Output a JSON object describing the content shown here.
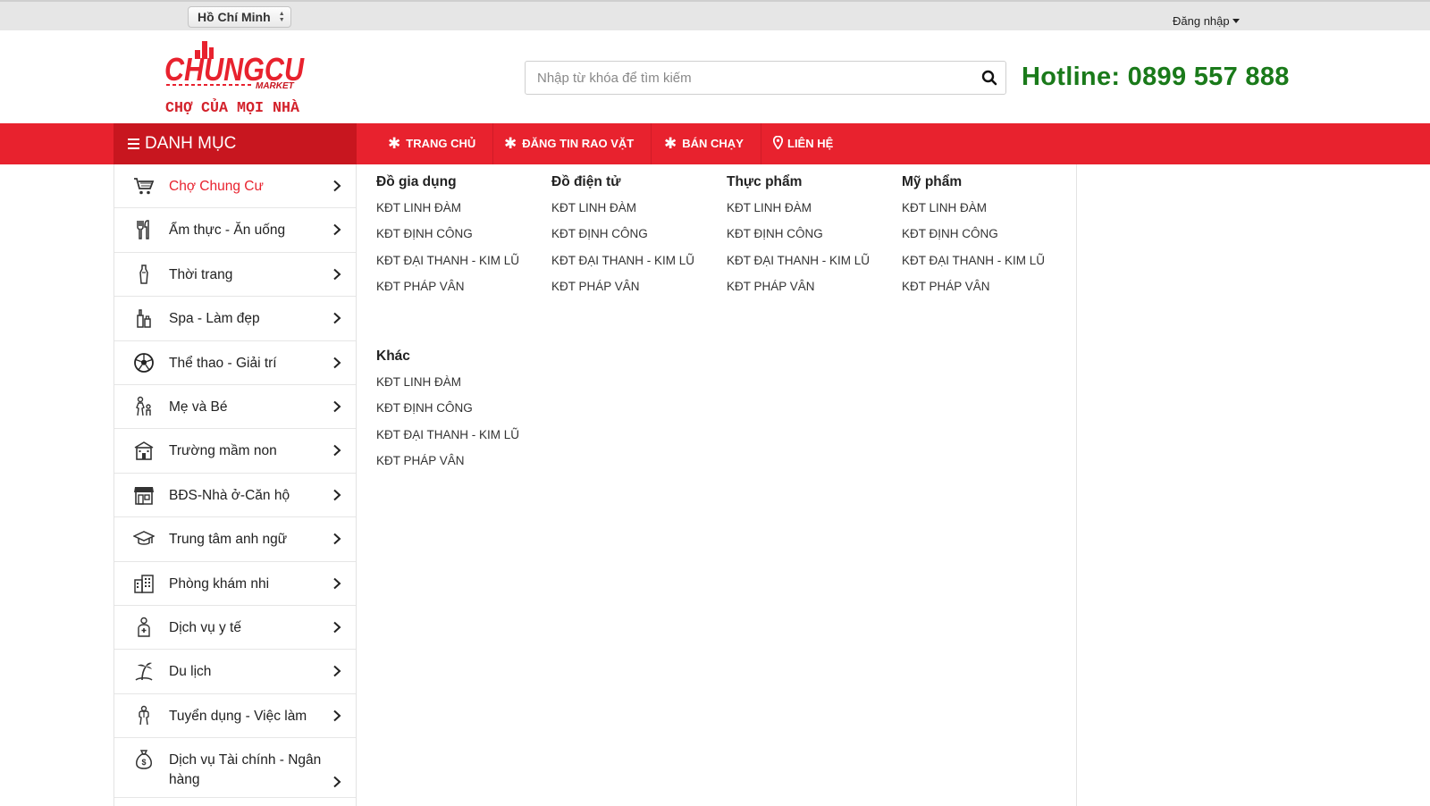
{
  "topbar": {
    "city": "Hồ Chí Minh",
    "login": "Đăng nhập"
  },
  "header": {
    "logo_top": "CHUNGCU",
    "logo_market": "MARKET",
    "logo_slogan": "CHỢ CỦA MỌI NHÀ",
    "search_placeholder": "Nhập từ khóa để tìm kiếm",
    "hotline": "Hotline: 0899 557 888"
  },
  "nav": {
    "categories_label": "DANH MỤC",
    "items": [
      {
        "label": "TRANG CHỦ",
        "icon": "asterisk-icon"
      },
      {
        "label": "ĐĂNG TIN RAO VẶT",
        "icon": "asterisk-icon"
      },
      {
        "label": "BÁN CHẠY",
        "icon": "asterisk-icon"
      },
      {
        "label": "LIÊN HỆ",
        "icon": "map-pin-icon"
      }
    ]
  },
  "sidebar": {
    "items": [
      {
        "label": "Chợ Chung Cư",
        "icon": "cart-icon",
        "active": true
      },
      {
        "label": "Ẩm thực - Ăn uống",
        "icon": "cutlery-icon"
      },
      {
        "label": "Thời trang",
        "icon": "dress-icon"
      },
      {
        "label": "Spa - Làm đẹp",
        "icon": "cosmetics-icon"
      },
      {
        "label": "Thể thao - Giải trí",
        "icon": "soccer-ball-icon"
      },
      {
        "label": "Mẹ và Bé",
        "icon": "mother-child-icon"
      },
      {
        "label": "Trường mầm non",
        "icon": "school-icon"
      },
      {
        "label": "BĐS-Nhà ở-Căn hộ",
        "icon": "storefront-icon"
      },
      {
        "label": "Trung tâm anh ngữ",
        "icon": "graduation-cap-icon"
      },
      {
        "label": "Phòng khám nhi",
        "icon": "building-icon"
      },
      {
        "label": "Dịch vụ y tế",
        "icon": "doctor-icon"
      },
      {
        "label": "Du lịch",
        "icon": "beach-icon"
      },
      {
        "label": "Tuyển dụng - Việc làm",
        "icon": "worker-icon"
      },
      {
        "label": "Dịch vụ Tài chính - Ngân hàng",
        "icon": "money-bag-icon"
      }
    ]
  },
  "mega": {
    "groups": [
      {
        "title": "Đồ gia dụng",
        "items": [
          "KĐT LINH ĐÀM",
          "KĐT ĐỊNH CÔNG",
          "KĐT ĐẠI THANH - KIM LŨ",
          "KĐT PHÁP VÂN"
        ]
      },
      {
        "title": "Đồ điện tử",
        "items": [
          "KĐT LINH ĐÀM",
          "KĐT ĐỊNH CÔNG",
          "KĐT ĐẠI THANH - KIM LŨ",
          "KĐT PHÁP VÂN"
        ]
      },
      {
        "title": "Thực phẩm",
        "items": [
          "KĐT LINH ĐÀM",
          "KĐT ĐỊNH CÔNG",
          "KĐT ĐẠI THANH - KIM LŨ",
          "KĐT PHÁP VÂN"
        ]
      },
      {
        "title": "Mỹ phẩm",
        "items": [
          "KĐT LINH ĐÀM",
          "KĐT ĐỊNH CÔNG",
          "KĐT ĐẠI THANH - KIM LŨ",
          "KĐT PHÁP VÂN"
        ]
      },
      {
        "title": "Khác",
        "items": [
          "KĐT LINH ĐÀM",
          "KĐT ĐỊNH CÔNG",
          "KĐT ĐẠI THANH - KIM LŨ",
          "KĐT PHÁP VÂN"
        ]
      }
    ]
  },
  "colors": {
    "brand_red": "#e8222e",
    "hotline_green": "#1a7a1a"
  }
}
